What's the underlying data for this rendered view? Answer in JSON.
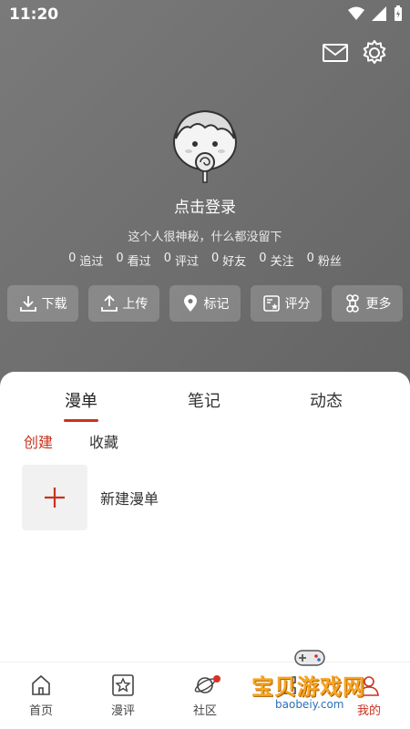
{
  "status_bar": {
    "time": "11:20"
  },
  "profile": {
    "login_prompt": "点击登录",
    "bio": "这个人很神秘，什么都没留下",
    "stats": [
      {
        "count": "0",
        "label": "追过"
      },
      {
        "count": "0",
        "label": "看过"
      },
      {
        "count": "0",
        "label": "评过"
      },
      {
        "count": "0",
        "label": "好友"
      },
      {
        "count": "0",
        "label": "关注"
      },
      {
        "count": "0",
        "label": "粉丝"
      }
    ]
  },
  "actions": [
    {
      "label": "下载",
      "icon": "download-icon"
    },
    {
      "label": "上传",
      "icon": "upload-icon"
    },
    {
      "label": "标记",
      "icon": "location-pin-icon"
    },
    {
      "label": "评分",
      "icon": "rating-icon"
    },
    {
      "label": "更多",
      "icon": "more-icon"
    }
  ],
  "tabs": [
    "漫单",
    "笔记",
    "动态"
  ],
  "active_tab": "漫单",
  "subtabs": [
    "创建",
    "收藏"
  ],
  "new_list_label": "新建漫单",
  "bottom_nav": [
    {
      "label": "首页",
      "icon": "home-icon"
    },
    {
      "label": "漫评",
      "icon": "star-box-icon"
    },
    {
      "label": "社区",
      "icon": "planet-icon"
    },
    {
      "label": "",
      "icon": "ticket-icon"
    },
    {
      "label": "我的",
      "icon": "user-icon"
    }
  ],
  "watermark": {
    "text": "宝贝游戏网",
    "url": "baobeiy.com"
  },
  "colors": {
    "accent": "#c7331e",
    "header_bg": "#707070"
  }
}
